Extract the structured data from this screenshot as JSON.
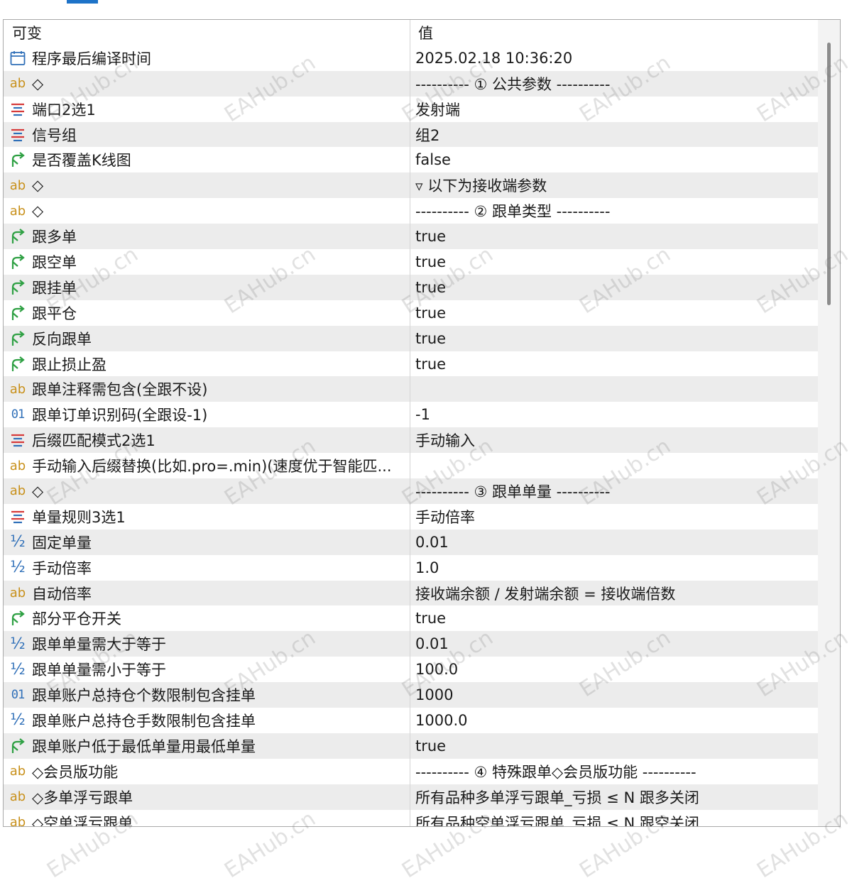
{
  "header": {
    "name": "可变",
    "value": "值"
  },
  "watermark": "EAHub.cn",
  "colors": {
    "tab_indicator": "#1e73c8",
    "row_alt": "#ececec",
    "text_icon": "#c8901a",
    "bool_icon": "#2ea043",
    "enum_icon": "#d63a3a",
    "num_icon": "#2f6fb8"
  },
  "rows": [
    {
      "icon": "calendar-icon",
      "name": "程序最后编译时间",
      "value": "2025.02.18 10:36:20"
    },
    {
      "icon": "text-icon",
      "icon_label": "ab",
      "name": "◇",
      "value": "---------- ① 公共参数 ----------"
    },
    {
      "icon": "enum-icon",
      "name": "端口2选1",
      "value": "发射端"
    },
    {
      "icon": "enum-icon",
      "name": "信号组",
      "value": "组2"
    },
    {
      "icon": "bool-icon",
      "name": "是否覆盖K线图",
      "value": "false"
    },
    {
      "icon": "text-icon",
      "icon_label": "ab",
      "name": "◇",
      "value": "▿ 以下为接收端参数"
    },
    {
      "icon": "text-icon",
      "icon_label": "ab",
      "name": "◇",
      "value": "---------- ② 跟单类型 ----------"
    },
    {
      "icon": "bool-icon",
      "name": "跟多单",
      "value": "true"
    },
    {
      "icon": "bool-icon",
      "name": "跟空单",
      "value": "true"
    },
    {
      "icon": "bool-icon",
      "name": "跟挂单",
      "value": "true"
    },
    {
      "icon": "bool-icon",
      "name": "跟平仓",
      "value": "true"
    },
    {
      "icon": "bool-icon",
      "name": "反向跟单",
      "value": "true"
    },
    {
      "icon": "bool-icon",
      "name": "跟止损止盈",
      "value": "true"
    },
    {
      "icon": "text-icon",
      "icon_label": "ab",
      "name": "跟单注释需包含(全跟不设)",
      "value": ""
    },
    {
      "icon": "int-icon",
      "icon_label": "01",
      "name": "跟单订单识别码(全跟设-1)",
      "value": "-1"
    },
    {
      "icon": "enum-icon",
      "name": "后缀匹配模式2选1",
      "value": "手动输入"
    },
    {
      "icon": "text-icon",
      "icon_label": "ab",
      "name": "手动输入后缀替换(比如.pro=.min)(速度优于智能匹...",
      "value": ""
    },
    {
      "icon": "text-icon",
      "icon_label": "ab",
      "name": "◇",
      "value": "---------- ③ 跟单单量 ----------"
    },
    {
      "icon": "enum-icon",
      "name": "单量规则3选1",
      "value": "手动倍率"
    },
    {
      "icon": "double-icon",
      "icon_label": "½",
      "name": "固定单量",
      "value": "0.01"
    },
    {
      "icon": "double-icon",
      "icon_label": "½",
      "name": "手动倍率",
      "value": "1.0"
    },
    {
      "icon": "text-icon",
      "icon_label": "ab",
      "name": "自动倍率",
      "value": "接收端余额 / 发射端余额 = 接收端倍数"
    },
    {
      "icon": "bool-icon",
      "name": "部分平仓开关",
      "value": "true"
    },
    {
      "icon": "double-icon",
      "icon_label": "½",
      "name": "跟单单量需大于等于",
      "value": "0.01"
    },
    {
      "icon": "double-icon",
      "icon_label": "½",
      "name": "跟单单量需小于等于",
      "value": "100.0"
    },
    {
      "icon": "int-icon",
      "icon_label": "01",
      "name": "跟单账户总持仓个数限制包含挂单",
      "value": "1000"
    },
    {
      "icon": "double-icon",
      "icon_label": "½",
      "name": "跟单账户总持仓手数限制包含挂单",
      "value": "1000.0"
    },
    {
      "icon": "bool-icon",
      "name": "跟单账户低于最低单量用最低单量",
      "value": "true"
    },
    {
      "icon": "text-icon",
      "icon_label": "ab",
      "name": "◇会员版功能",
      "value": "---------- ④ 特殊跟单◇会员版功能 ----------"
    },
    {
      "icon": "text-icon",
      "icon_label": "ab",
      "name": "◇多单浮亏跟单",
      "value": "所有品种多单浮亏跟单_亏损 ≤ N 跟多关闭"
    },
    {
      "icon": "text-icon",
      "icon_label": "ab",
      "name": "◇空单浮亏跟单",
      "value": "所有品种空单浮亏跟单_亏损 ≤ N 跟空关闭"
    }
  ]
}
